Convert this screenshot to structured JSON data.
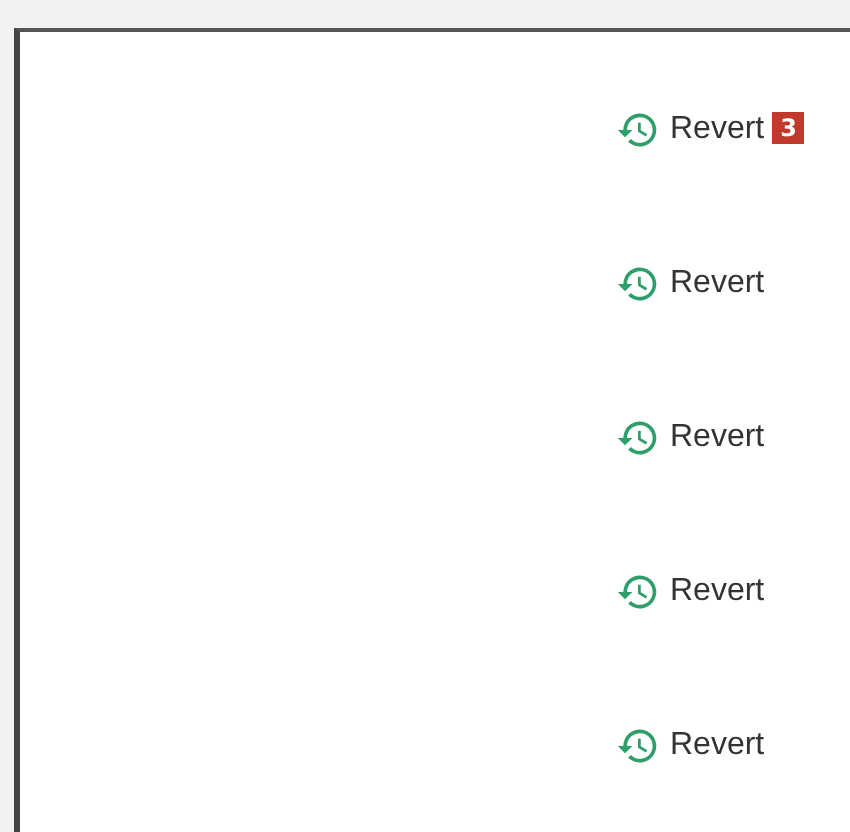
{
  "rows": [
    {
      "action": "Revert",
      "badge": "3"
    },
    {
      "action": "Revert"
    },
    {
      "action": "Revert"
    },
    {
      "action": "Revert"
    },
    {
      "action": "Revert"
    }
  ]
}
